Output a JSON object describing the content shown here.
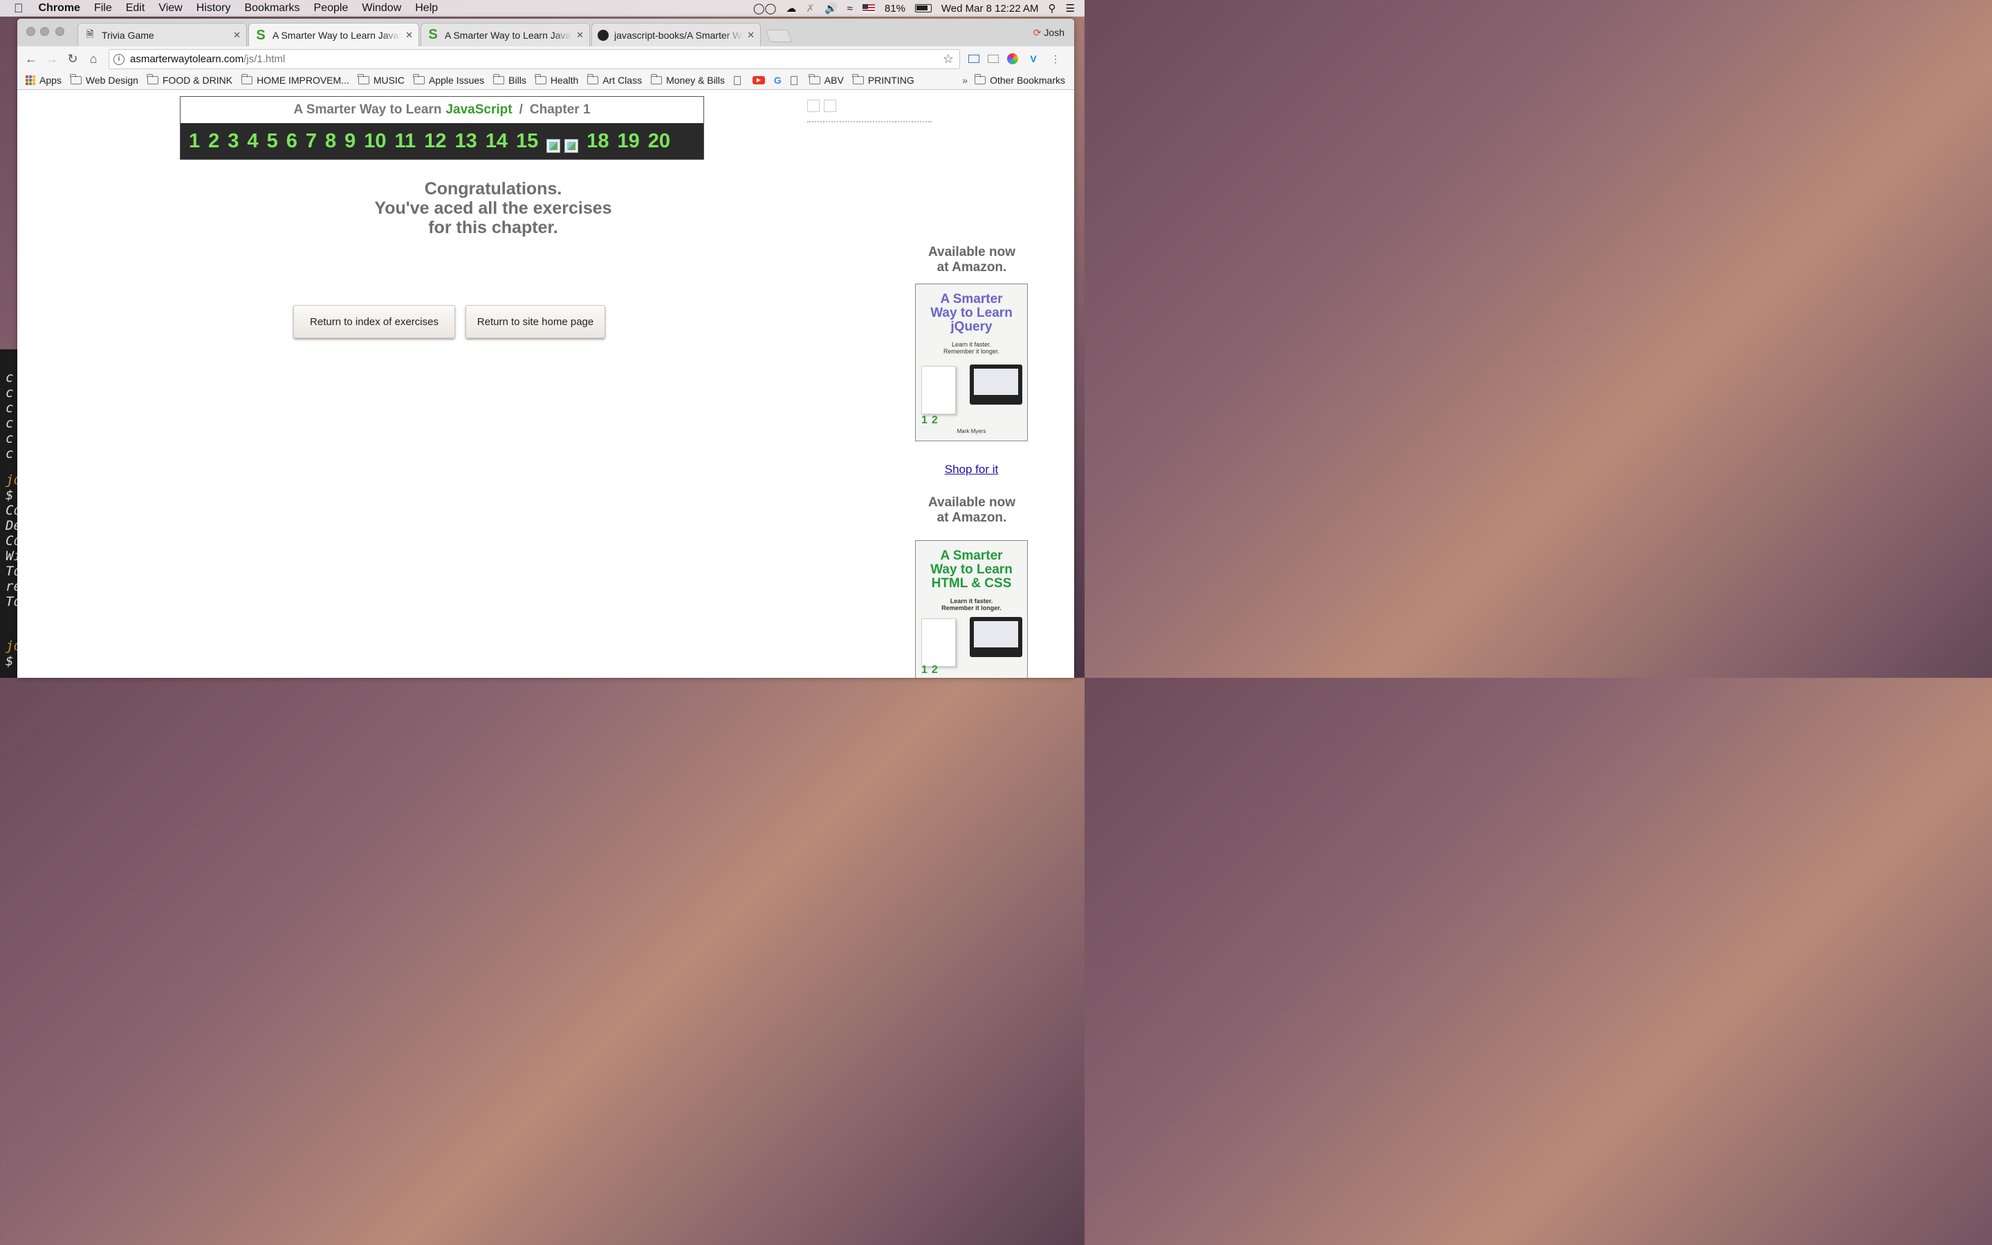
{
  "menubar": {
    "apple": "",
    "app": "Chrome",
    "items": [
      "File",
      "Edit",
      "View",
      "History",
      "Bookmarks",
      "People",
      "Window",
      "Help"
    ],
    "battery": "81%",
    "clock": "Wed Mar 8  12:22 AM"
  },
  "tabs": [
    {
      "title": "Trivia Game",
      "icon": "page-icon"
    },
    {
      "title": "A Smarter Way to Learn JavaScript",
      "icon": "s-logo-icon",
      "active": true
    },
    {
      "title": "A Smarter Way to Learn JavaScript",
      "icon": "s-logo-icon"
    },
    {
      "title": "javascript-books/A Smarter Way",
      "icon": "github-icon"
    }
  ],
  "profile": "Josh",
  "omnibox": {
    "host": "asmarterwaytolearn.com",
    "path": "/js/1.html"
  },
  "bookmarks": [
    "Apps",
    "Web Design",
    "FOOD & DRINK",
    "HOME IMPROVEM...",
    "MUSIC",
    "Apple Issues",
    "Bills",
    "Health",
    "Art Class",
    "Money & Bills",
    "ABV",
    "PRINTING",
    "Other Bookmarks"
  ],
  "bookmarks_more": "»",
  "chapter_nav": {
    "prefix": "A Smarter Way to Learn",
    "brand": "JavaScript",
    "separator": "/",
    "chapter": "Chapter 1",
    "numbers_a": [
      "1",
      "2",
      "3",
      "4",
      "5",
      "6",
      "7",
      "8",
      "9",
      "10",
      "11",
      "12",
      "13",
      "14",
      "15"
    ],
    "numbers_b": [
      "18",
      "19",
      "20"
    ]
  },
  "congrats": {
    "line1": "Congratulations.",
    "line2": "You've aced all the exercises",
    "line3": "for this chapter."
  },
  "buttons": {
    "index": "Return to index of exercises",
    "home": "Return to site home page"
  },
  "sidebar": {
    "avail1_a": "Available now",
    "avail1_b": "at Amazon.",
    "book1": {
      "l1": "A Smarter",
      "l2": "Way to Learn",
      "l3": "jQuery",
      "sub1": "Learn it faster.",
      "sub2": "Remember it longer.",
      "author": "Mark Myers",
      "color": "#6b63c9"
    },
    "shop": "Shop for it",
    "avail2_a": "Available now",
    "avail2_b": "at Amazon.",
    "book2": {
      "l1": "A Smarter",
      "l2": "Way to Learn",
      "l3": "HTML & CSS",
      "sub1": "Learn it faster.",
      "sub2": "Remember it longer.",
      "color": "#1f9a3a"
    }
  },
  "terminal_lines": [
    "c",
    "c",
    "c",
    "c",
    "c",
    "c",
    "jo",
    "$",
    "Co",
    "De",
    "Co",
    "Wi",
    "To",
    "re",
    "To",
    "jo",
    "$"
  ]
}
